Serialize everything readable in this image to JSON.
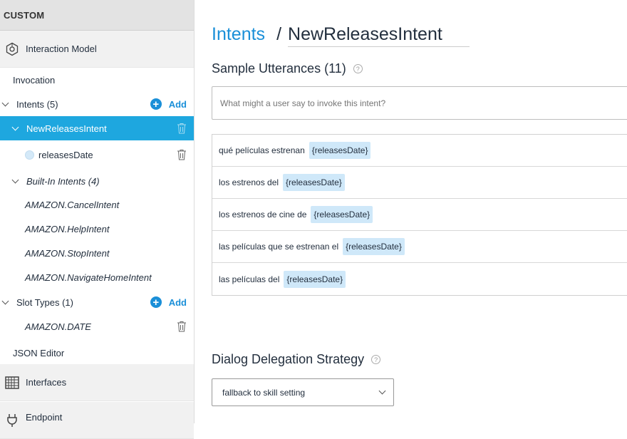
{
  "sidebar": {
    "header": "CUSTOM",
    "interaction_model": "Interaction Model",
    "invocation": "Invocation",
    "intents_label": "Intents (5)",
    "add_label": "Add",
    "selected_intent": "NewReleasesIntent",
    "slot_name": "releasesDate",
    "builtin_label": "Built-In Intents (4)",
    "builtin_intents": [
      "AMAZON.CancelIntent",
      "AMAZON.HelpIntent",
      "AMAZON.StopIntent",
      "AMAZON.NavigateHomeIntent"
    ],
    "slot_types_label": "Slot Types (1)",
    "slot_type": "AMAZON.DATE",
    "json_editor": "JSON Editor",
    "interfaces": "Interfaces",
    "endpoint": "Endpoint",
    "accent_color": "#1ea7df"
  },
  "main": {
    "breadcrumb_link": "Intents",
    "breadcrumb_sep": "/",
    "intent_name": "NewReleasesIntent",
    "sample_title": "Sample Utterances (11)",
    "help_glyph": "?",
    "input_placeholder": "What might a user say to invoke this intent?",
    "utterances": [
      {
        "text": "qué películas estrenan",
        "slot": "{releasesDate}"
      },
      {
        "text": "los estrenos del",
        "slot": "{releasesDate}"
      },
      {
        "text": "los estrenos de cine de",
        "slot": "{releasesDate}"
      },
      {
        "text": "las películas que se estrenan el",
        "slot": "{releasesDate}"
      },
      {
        "text": "las películas del",
        "slot": "{releasesDate}"
      }
    ],
    "dialog_title": "Dialog Delegation Strategy",
    "dialog_value": "fallback to skill setting",
    "link_color": "#1a8fd8"
  }
}
